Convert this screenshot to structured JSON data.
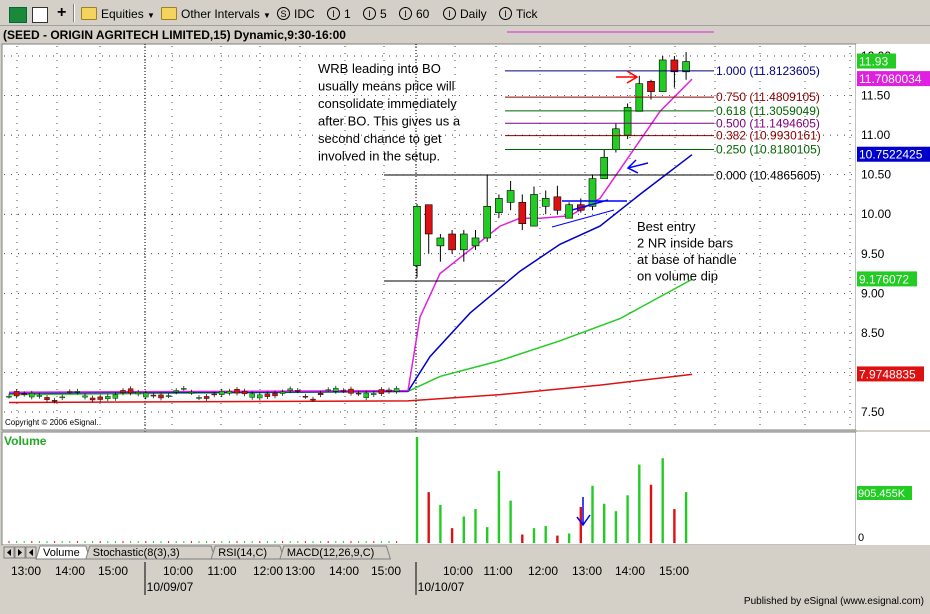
{
  "toolbar": {
    "equities": "Equities",
    "intervals": "Other Intervals",
    "idc": "IDC",
    "i1": "1",
    "i5": "5",
    "i60": "60",
    "daily": "Daily",
    "tick": "Tick"
  },
  "header": {
    "title": "(SEED - ORIGIN AGRITECH LIMITED,15) Dynamic,9:30-16:00"
  },
  "copyright": "Copyright © 2006 eSignal.",
  "volume_label": "Volume",
  "tabs": [
    "Volume",
    "Stochastic(8(3),3)",
    "RSI(14,C)",
    "MACD(12,26,9,C)"
  ],
  "price_axis": [
    "12.00",
    "11.50",
    "11.00",
    "10.50",
    "10.00",
    "9.50",
    "9.00",
    "8.50",
    "8.00",
    "7.50"
  ],
  "price_flags": [
    {
      "text": "11.93",
      "bg": "#22cc22",
      "fg": "#ffffff",
      "price": 11.93
    },
    {
      "text": "11.7080034",
      "bg": "#e020e0",
      "fg": "#ffffff",
      "price": 11.708
    },
    {
      "text": "10.7522425",
      "bg": "#0000cc",
      "fg": "#ffffff",
      "price": 10.752
    },
    {
      "text": "9.176072",
      "bg": "#22cc22",
      "fg": "#ffffff",
      "price": 9.176
    },
    {
      "text": "7.9748835",
      "bg": "#dd1111",
      "fg": "#ffffff",
      "price": 7.975
    }
  ],
  "volume_axis": [
    "0"
  ],
  "volume_flag": {
    "text": "905.455K",
    "bg": "#22cc22",
    "fg": "#ffffff"
  },
  "fib_levels": [
    {
      "label": "1.000 (11.8123605)",
      "price": 11.8124,
      "color": "#000080"
    },
    {
      "label": "0.750 (11.4809105)",
      "price": 11.4809,
      "color": "#8b0000"
    },
    {
      "label": "0.618 (11.3059049)",
      "price": 11.3059,
      "color": "#006400"
    },
    {
      "label": "0.500 (11.1494605)",
      "price": 11.1495,
      "color": "#800080"
    },
    {
      "label": "0.382 (10.9930161)",
      "price": 10.993,
      "color": "#8b0000"
    },
    {
      "label": "0.250 (10.8180105)",
      "price": 10.818,
      "color": "#006400"
    },
    {
      "label": "0.000 (10.4865605)",
      "price": 10.4866,
      "color": "#000000"
    }
  ],
  "annotations": {
    "wrb": [
      "WRB leading into BO",
      "usually means price will",
      "consolidate immediately",
      "after BO.  This gives us a",
      "second chance to get",
      "involved in the setup."
    ],
    "entry": [
      "Best entry",
      "2 NR inside bars",
      "at base of handle",
      "on volume dip"
    ]
  },
  "time_axis": [
    "13:00",
    "14:00",
    "15:00",
    "10:00",
    "11:00",
    "12:00",
    "13:00",
    "14:00",
    "15:00",
    "10:00",
    "11:00",
    "12:00",
    "13:00",
    "14:00",
    "15:00"
  ],
  "date_labels": [
    "10/09/07",
    "10/10/07"
  ],
  "published": "Published by eSignal (www.esignal.com)",
  "chart_data": {
    "type": "candlestick",
    "title": "(SEED - ORIGIN AGRITECH LIMITED,15) Dynamic,9:30-16:00",
    "interval": "15 min",
    "ylim": [
      7.3,
      12.15
    ],
    "breakout_candles": [
      {
        "o": 9.35,
        "h": 10.13,
        "l": 9.2,
        "c": 10.1
      },
      {
        "o": 10.12,
        "h": 10.12,
        "l": 9.5,
        "c": 9.75
      },
      {
        "o": 9.6,
        "h": 9.75,
        "l": 9.4,
        "c": 9.7
      },
      {
        "o": 9.75,
        "h": 9.8,
        "l": 9.5,
        "c": 9.55
      },
      {
        "o": 9.55,
        "h": 9.8,
        "l": 9.4,
        "c": 9.75
      },
      {
        "o": 9.6,
        "h": 9.8,
        "l": 9.55,
        "c": 9.7
      },
      {
        "o": 9.7,
        "h": 10.5,
        "l": 9.65,
        "c": 10.1
      },
      {
        "o": 10.02,
        "h": 10.25,
        "l": 9.95,
        "c": 10.2
      },
      {
        "o": 10.15,
        "h": 10.42,
        "l": 10.05,
        "c": 10.3
      },
      {
        "o": 10.15,
        "h": 10.25,
        "l": 9.8,
        "c": 9.88
      },
      {
        "o": 9.85,
        "h": 10.35,
        "l": 9.85,
        "c": 10.25
      },
      {
        "o": 10.1,
        "h": 10.3,
        "l": 10.0,
        "c": 10.2
      },
      {
        "o": 10.22,
        "h": 10.36,
        "l": 10.0,
        "c": 10.05
      },
      {
        "o": 9.95,
        "h": 10.15,
        "l": 9.95,
        "c": 10.12
      },
      {
        "o": 10.12,
        "h": 10.2,
        "l": 10.02,
        "c": 10.05
      },
      {
        "o": 10.1,
        "h": 10.5,
        "l": 10.05,
        "c": 10.45
      },
      {
        "o": 10.45,
        "h": 10.82,
        "l": 10.45,
        "c": 10.72
      },
      {
        "o": 10.82,
        "h": 11.15,
        "l": 10.78,
        "c": 11.08
      },
      {
        "o": 11.0,
        "h": 11.4,
        "l": 10.95,
        "c": 11.35
      },
      {
        "o": 11.3,
        "h": 11.75,
        "l": 11.3,
        "c": 11.65
      },
      {
        "o": 11.68,
        "h": 11.7,
        "l": 11.45,
        "c": 11.55
      },
      {
        "o": 11.55,
        "h": 12.0,
        "l": 11.55,
        "c": 11.95
      },
      {
        "o": 11.95,
        "h": 12.0,
        "l": 11.6,
        "c": 11.8
      },
      {
        "o": 11.8,
        "h": 12.05,
        "l": 11.7,
        "c": 11.93
      }
    ],
    "volume_bars": [
      100,
      48,
      36,
      14,
      25,
      32,
      15,
      68,
      40,
      8,
      14,
      16,
      7,
      9,
      34,
      54,
      37,
      30,
      45,
      74,
      55,
      80,
      32,
      48
    ],
    "pre_breakout_price_range": [
      7.6,
      7.88
    ],
    "moving_averages": [
      {
        "color": "#e020e0",
        "last": 11.708
      },
      {
        "color": "#0000cc",
        "last": 10.752
      },
      {
        "color": "#22cc22",
        "last": 9.176
      },
      {
        "color": "#dd1111",
        "last": 7.975
      }
    ],
    "grid": true
  }
}
